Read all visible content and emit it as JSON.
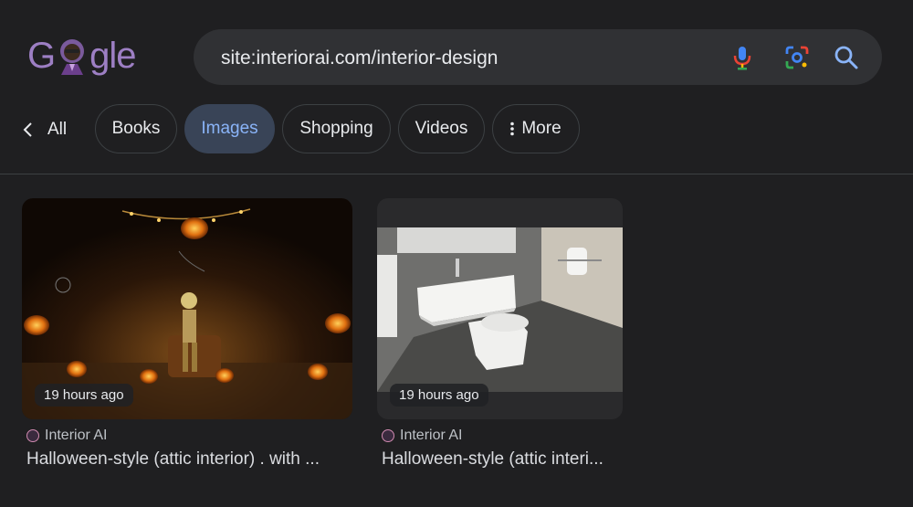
{
  "logo": {
    "text_left": "G",
    "text_right": "gle"
  },
  "search": {
    "query": "site:interiorai.com/interior-design"
  },
  "chips": {
    "back_label": "All",
    "items": [
      {
        "label": "Books",
        "active": false
      },
      {
        "label": "Images",
        "active": true
      },
      {
        "label": "Shopping",
        "active": false
      },
      {
        "label": "Videos",
        "active": false
      }
    ],
    "more_label": "More"
  },
  "results": [
    {
      "time": "19 hours ago",
      "source": "Interior AI",
      "title": "Halloween-style (attic interior) . with ..."
    },
    {
      "time": "19 hours ago",
      "source": "Interior AI",
      "title": "Halloween-style (attic interi..."
    }
  ],
  "colors": {
    "background": "#1f1f21",
    "accent": "#8ab4f8",
    "active_chip": "#394457",
    "logo": "#9d7fc4"
  }
}
